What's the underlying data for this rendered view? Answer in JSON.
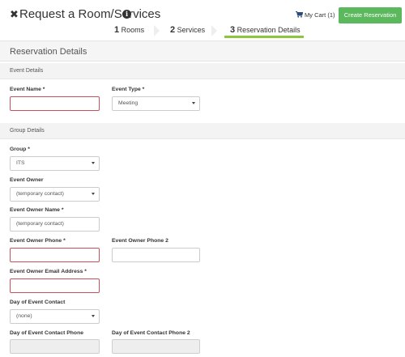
{
  "header": {
    "title": "Request a Room/Services",
    "info_icon": "info-icon",
    "cart_label": "My Cart (1)",
    "create_button": "Create Reservation"
  },
  "steps": [
    {
      "num": "1",
      "label": "Rooms"
    },
    {
      "num": "2",
      "label": "Services"
    },
    {
      "num": "3",
      "label": "Reservation Details"
    }
  ],
  "panel": {
    "title": "Reservation Details"
  },
  "sections": {
    "event_details": "Event Details",
    "group_details": "Group Details"
  },
  "fields": {
    "event_name": {
      "label": "Event Name *",
      "value": ""
    },
    "event_type": {
      "label": "Event Type *",
      "value": "Meeting"
    },
    "group": {
      "label": "Group *",
      "value": "ITS"
    },
    "event_owner": {
      "label": "Event Owner",
      "value": "(temporary contact)"
    },
    "event_owner_name": {
      "label": "Event Owner Name *",
      "value": "(temporary contact)"
    },
    "event_owner_phone": {
      "label": "Event Owner Phone *",
      "value": ""
    },
    "event_owner_phone2": {
      "label": "Event Owner Phone 2",
      "value": ""
    },
    "event_owner_email": {
      "label": "Event Owner Email Address *",
      "value": ""
    },
    "day_of_event_contact": {
      "label": "Day of Event Contact",
      "value": "(none)"
    },
    "day_of_event_contact_phone": {
      "label": "Day of Event Contact Phone",
      "value": ""
    },
    "day_of_event_contact_phone2": {
      "label": "Day of Event Contact Phone 2",
      "value": ""
    }
  },
  "colors": {
    "accent_green": "#5cb85c",
    "step_underline": "#8cc63f",
    "required_border": "#c9505a"
  }
}
